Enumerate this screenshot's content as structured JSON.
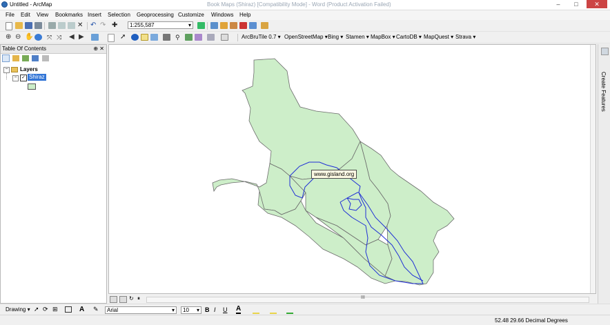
{
  "window": {
    "title": "Untitled - ArcMap",
    "background_title": "Book Maps (Shiraz) [Compatibility Mode] - Word (Product Activation Failed)",
    "controls": [
      "–",
      "□",
      "✕"
    ]
  },
  "menu": [
    "File",
    "Edit",
    "View",
    "Bookmarks",
    "Insert",
    "Selection",
    "Geoprocessing",
    "Customize",
    "Windows",
    "Help"
  ],
  "standard_toolbar": {
    "scale": "1:255,587"
  },
  "basemap_toolbar": [
    "ArcBruTile 0.7 ▾",
    "OpenStreetMap ▾",
    "Bing ▾",
    "Stamen ▾",
    "MapBox ▾",
    "CartoDB ▾",
    "MapQuest ▾",
    "Strava ▾"
  ],
  "toc": {
    "title": "Table Of Contents",
    "pin": "⊕ ✕",
    "root": "Layers",
    "layer": "Shiraz",
    "layer_checked": true,
    "symbol_color": "#cdeec9"
  },
  "map": {
    "watermark": "www.gisland.org",
    "fill_color": "#cdeec9",
    "outline_color": "#6b6b6b",
    "boundary_color": "#1f2fd6"
  },
  "right_panel": {
    "label": "Create Features"
  },
  "drawing_toolbar": {
    "label": "Drawing ▾",
    "font": "Arial",
    "size": "10",
    "bold": "B",
    "italic": "I",
    "underline": "U"
  },
  "status": {
    "coordinates": "52.48  29.66 Decimal Degrees"
  },
  "map_strip": {
    "scroll_marker": "III"
  }
}
